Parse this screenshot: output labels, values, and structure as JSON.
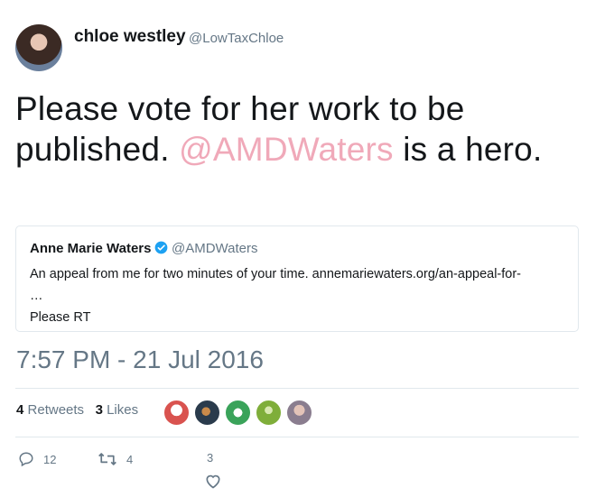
{
  "tweet": {
    "author_name": "chloe westley",
    "author_handle": "@LowTaxChloe",
    "text_before": "Please vote for her work to be published. ",
    "mention": "@AMDWaters",
    "text_after": " is a hero.",
    "timestamp": "7:57 PM - 21 Jul 2016"
  },
  "quoted": {
    "name": "Anne Marie Waters",
    "handle": "@AMDWaters",
    "text": "An appeal from me for two minutes of your time.  annemariewaters.org/an-appeal-for-\n…\nPlease RT"
  },
  "stats": {
    "retweets_count": "4",
    "retweets_label": "Retweets",
    "likes_count": "3",
    "likes_label": "Likes"
  },
  "actions": {
    "reply_count": "12",
    "retweet_count": "4",
    "like_count": "3"
  },
  "colors": {
    "mention": "#f0a9b9",
    "verified": "#1da1f2",
    "muted": "#657786"
  },
  "likers": [
    {
      "icon": "avatar-britain-badge",
      "color": "#d9534f"
    },
    {
      "icon": "avatar-bird",
      "color": "#2a3b4c"
    },
    {
      "icon": "avatar-flag",
      "color": "#3aa35a"
    },
    {
      "icon": "avatar-tree",
      "color": "#7fae3a"
    },
    {
      "icon": "avatar-person",
      "color": "#8a7d8f"
    }
  ]
}
